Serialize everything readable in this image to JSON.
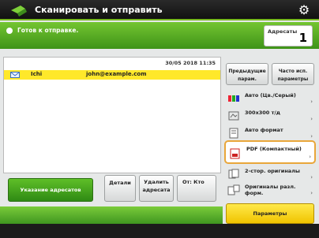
{
  "header": {
    "title": "Сканировать и отправить",
    "settings_icon": "gear-icon"
  },
  "status": {
    "text": "Готов к отправке.",
    "addresses_label": "Адресаты",
    "addresses_count": "1"
  },
  "list": {
    "datetime": "30/05 2018 11:35",
    "rows": [
      {
        "name": "Ichi",
        "email": "john@example.com"
      }
    ]
  },
  "buttons": {
    "specify": "Указание адресатов",
    "details": "Детали",
    "delete": "Удалить адресата",
    "from": "От: Кто"
  },
  "right": {
    "prev": "Предыдущие парам.",
    "freq": "Часто исп. параметры",
    "options": [
      {
        "label": "Авто (Цв./Серый)"
      },
      {
        "label": "300x300 т/д"
      },
      {
        "label": "Авто формат"
      },
      {
        "label": "PDF (Компактный)"
      },
      {
        "label": "2-стор. оригиналы"
      },
      {
        "label": "Оригиналы разл. форм."
      }
    ],
    "params": "Параметры"
  },
  "colors": {
    "accent": "#78b81f",
    "highlight": "#ffe82a",
    "focus": "#e9a63a"
  }
}
